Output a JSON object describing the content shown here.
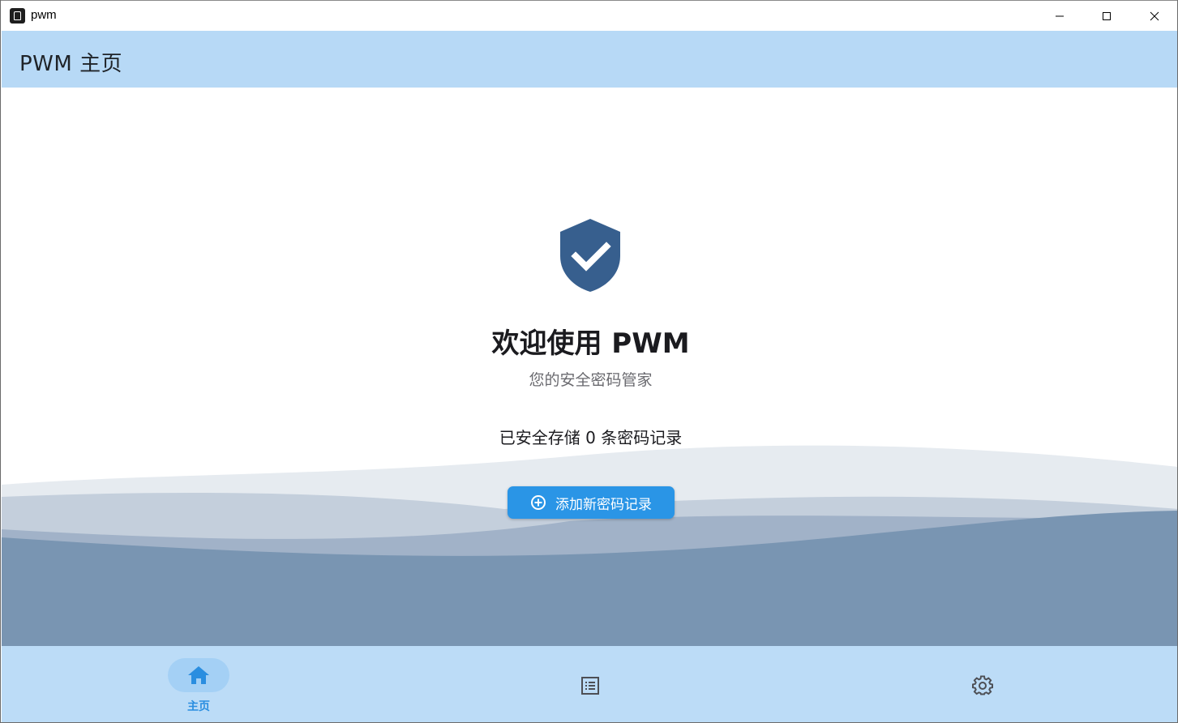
{
  "window": {
    "title": "pwm"
  },
  "appbar": {
    "title": "PWM 主页"
  },
  "main": {
    "welcome_title": "欢迎使用 PWM",
    "tagline": "您的安全密码管家",
    "record_count_text": "已安全存储 0 条密码记录",
    "add_button_label": "添加新密码记录"
  },
  "bottom_nav": {
    "items": [
      {
        "label": "主页",
        "icon": "home-icon",
        "selected": true
      },
      {
        "label": "",
        "icon": "list-icon",
        "selected": false
      },
      {
        "label": "",
        "icon": "gear-icon",
        "selected": false
      }
    ]
  },
  "colors": {
    "appbar": "#b7d9f6",
    "bottom_nav": "#bcdcf7",
    "accent": "#2a95e6",
    "shield": "#375f8e",
    "wave_dark": "#7995b2"
  }
}
